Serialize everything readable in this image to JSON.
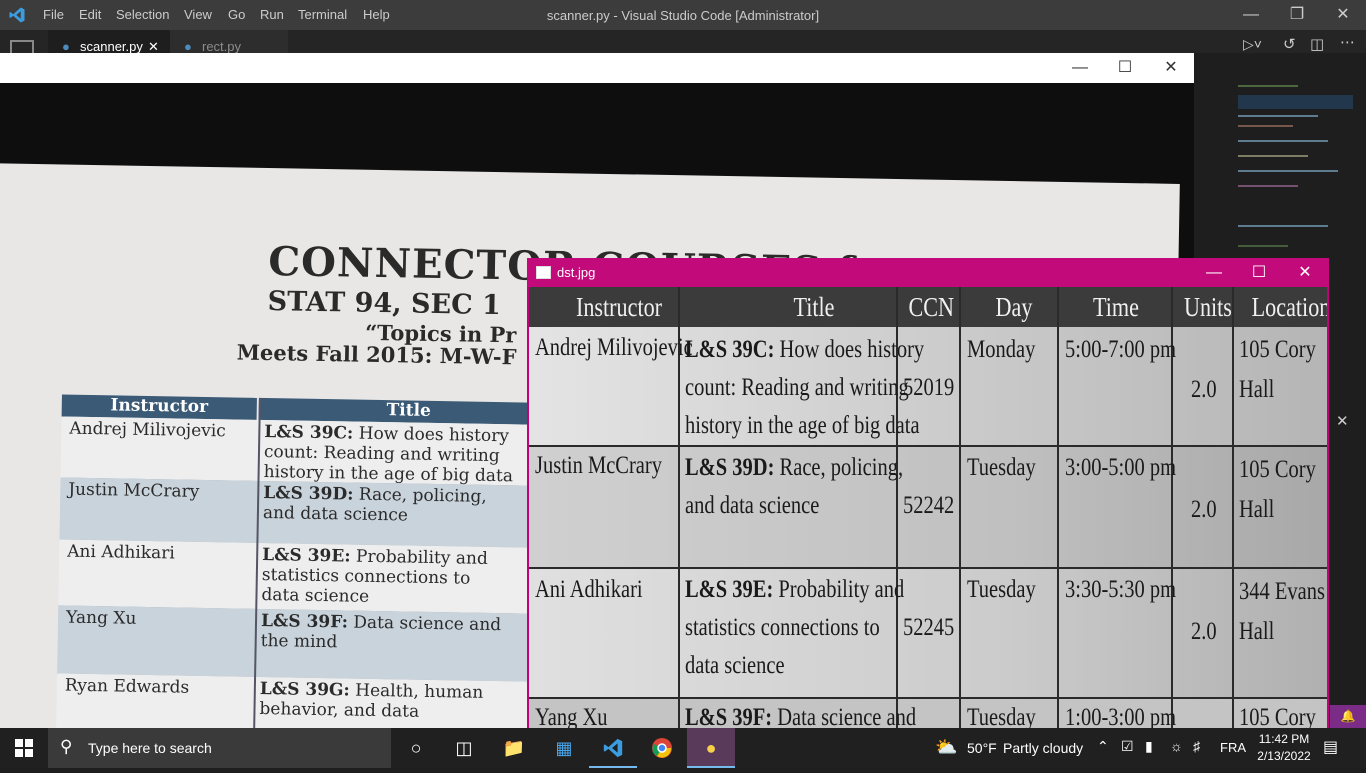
{
  "vscode": {
    "menu": [
      "File",
      "Edit",
      "Selection",
      "View",
      "Go",
      "Run",
      "Terminal",
      "Help"
    ],
    "window_title": "scanner.py - Visual Studio Code [Administrator]",
    "tabs": [
      {
        "label": "scanner.py",
        "close": "✕"
      },
      {
        "label": "rect.py"
      }
    ]
  },
  "image_window": {
    "doc_title_line1": "CONNECTOR COURSES for",
    "doc_title_line2": "STAT 94, SEC 1",
    "doc_subtitle": "“Topics in Pr",
    "doc_meets": "Meets Fall 2015: M-W-F",
    "headers": [
      "Instructor",
      "Title"
    ],
    "rows": [
      {
        "instructor": "Andrej Milivojevic",
        "title_code": "L&S 39C:",
        "title_rest": "How does history count: Reading and writing history in the age of big data"
      },
      {
        "instructor": "Justin McCrary",
        "title_code": "L&S 39D:",
        "title_rest": "Race, policing, and data science"
      },
      {
        "instructor": "Ani Adhikari",
        "title_code": "L&S 39E:",
        "title_rest": "Probability and statistics connections to data science"
      },
      {
        "instructor": "Yang Xu",
        "title_code": "L&S 39F:",
        "title_rest": "Data science and the mind"
      },
      {
        "instructor": "Ryan Edwards",
        "title_code": "L&S 39G:",
        "title_rest": "Health, human behavior, and data"
      }
    ]
  },
  "dst_window": {
    "title": "dst.jpg",
    "headers": [
      "Instructor",
      "Title",
      "CCN",
      "Day",
      "Time",
      "Units",
      "Location"
    ],
    "rows": [
      {
        "instructor": "Andrej Milivojevic",
        "code": "L&S 39C:",
        "title_l1": "How does history",
        "title_l2": "count: Reading and writing",
        "title_l3": "history in the age of big data",
        "ccn": "52019",
        "day": "Monday",
        "time": "5:00-7:00 pm",
        "units": "2.0",
        "loc1": "105 Cory",
        "loc2": "Hall"
      },
      {
        "instructor": "Justin McCrary",
        "code": "L&S 39D:",
        "title_l1": "Race, policing,",
        "title_l2": "and data science",
        "title_l3": "",
        "ccn": "52242",
        "day": "Tuesday",
        "time": "3:00-5:00 pm",
        "units": "2.0",
        "loc1": "105 Cory",
        "loc2": "Hall"
      },
      {
        "instructor": "Ani Adhikari",
        "code": "L&S 39E:",
        "title_l1": "Probability and",
        "title_l2": "statistics connections to",
        "title_l3": "data science",
        "ccn": "52245",
        "day": "Tuesday",
        "time": "3:30-5:30 pm",
        "units": "2.0",
        "loc1": "344 Evans",
        "loc2": "Hall"
      },
      {
        "instructor": "Yang Xu",
        "code": "L&S 39F:",
        "title_l1": "Data science and",
        "title_l2": "",
        "title_l3": "",
        "ccn": "",
        "day": "Tuesday",
        "time": "1:00-3:00 pm",
        "units": "",
        "loc1": "105 Cory",
        "loc2": ""
      }
    ]
  },
  "taskbar": {
    "search_placeholder": "Type here to search",
    "weather_temp": "50°F",
    "weather_text": "Partly cloudy",
    "language": "FRA",
    "time": "11:42 PM",
    "date": "2/13/2022"
  },
  "colors": {
    "vscode_titlebar": "#3c3c3c",
    "dst_titlebar": "#c20a7a",
    "table_header": "#3a5a76",
    "taskbar_active": "#5a3a5a"
  }
}
